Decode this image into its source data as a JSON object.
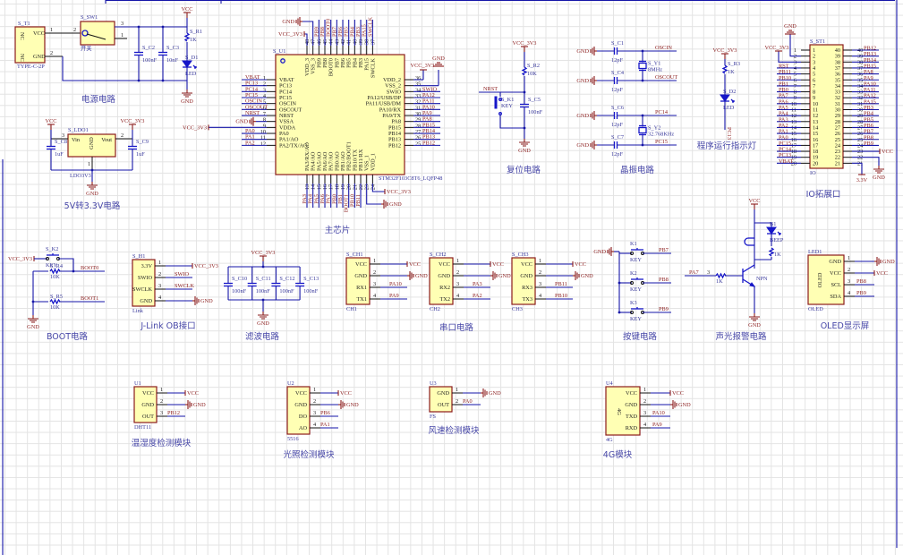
{
  "power": {
    "title": "电源电路",
    "vcc": "VCC",
    "gnd": "GND",
    "connector": {
      "ref": "S_T1",
      "value": "TYPE-C-2P",
      "pins": [
        {
          "num": "1",
          "name": "VCC"
        },
        {
          "num": "2",
          "name": "GND"
        }
      ],
      "nc": "NC"
    },
    "switch": {
      "ref": "S_SW1",
      "value": "开关",
      "pins": [
        "1",
        "2",
        "3"
      ]
    },
    "caps": [
      {
        "ref": "S_C2",
        "value": "100nF"
      },
      {
        "ref": "S_C3",
        "value": "10nF"
      }
    ],
    "resistor": {
      "ref": "S_R1",
      "value": "1K"
    },
    "led": {
      "ref": "S_D1",
      "value": "LED"
    }
  },
  "ldo": {
    "title": "5V转3.3V电路",
    "ref": "S_LDO1",
    "value": "LDO3V3",
    "vin": "Vin",
    "vout": "Vout",
    "gnd_pin": "GND",
    "pins": [
      "3",
      "2",
      "1"
    ],
    "in_net": "VCC",
    "out_net": "VCC_3V3",
    "gnd": "GND",
    "caps": [
      {
        "ref": "S_C8",
        "value": "1uF"
      },
      {
        "ref": "S_C9",
        "value": "1uF"
      }
    ]
  },
  "mcu": {
    "title": "主芯片",
    "ref": "S_U1",
    "value": "STM32F103C8T6_LQFP48",
    "left": [
      {
        "num": "1",
        "name": "VBAT",
        "net": "VBAT"
      },
      {
        "num": "2",
        "name": "PC13",
        "net": "PC13"
      },
      {
        "num": "3",
        "name": "PC14",
        "net": "PC14"
      },
      {
        "num": "4",
        "name": "PC15",
        "net": "PC15"
      },
      {
        "num": "5",
        "name": "OSCIN",
        "net": "OSCIN"
      },
      {
        "num": "6",
        "name": "OSCOUT",
        "net": "OSCOUT"
      },
      {
        "num": "7",
        "name": "NRST",
        "net": "NRST"
      },
      {
        "num": "8",
        "name": "VSSA",
        "net": "GND"
      },
      {
        "num": "9",
        "name": "VDDA",
        "net": "VCC_3V3"
      },
      {
        "num": "10",
        "name": "PA0",
        "net": "PA0"
      },
      {
        "num": "11",
        "name": "PA1/AO",
        "net": "PA1"
      },
      {
        "num": "12",
        "name": "PA2/TX/AO",
        "net": "PA2"
      }
    ],
    "right": [
      {
        "num": "36",
        "name": "VDD_2",
        "net": "VCC_3V3"
      },
      {
        "num": "35",
        "name": "VSS_2",
        "net": "GND"
      },
      {
        "num": "34",
        "name": "SWIO",
        "net": "SWIO"
      },
      {
        "num": "33",
        "name": "PA12/USB/DP",
        "net": "PA12"
      },
      {
        "num": "32",
        "name": "PA11/USB/DM",
        "net": "PA11"
      },
      {
        "num": "31",
        "name": "PA10/RX",
        "net": "PA10"
      },
      {
        "num": "30",
        "name": "PA9/TX",
        "net": "PA9"
      },
      {
        "num": "29",
        "name": "PA8",
        "net": "PA8"
      },
      {
        "num": "28",
        "name": "PB15",
        "net": "PB15"
      },
      {
        "num": "27",
        "name": "PB14",
        "net": "PB14"
      },
      {
        "num": "26",
        "name": "PB13",
        "net": "PB13"
      },
      {
        "num": "25",
        "name": "PB12",
        "net": "PB12"
      }
    ],
    "top": [
      {
        "num": "48",
        "name": "VDD_3",
        "net": "VCC_3V3"
      },
      {
        "num": "47",
        "name": "VSS_3",
        "net": "GND"
      },
      {
        "num": "46",
        "name": "PB9",
        "net": "PB9"
      },
      {
        "num": "45",
        "name": "PB8",
        "net": "PB8"
      },
      {
        "num": "44",
        "name": "BOOT0",
        "net": "BOOT0"
      },
      {
        "num": "43",
        "name": "PB7",
        "net": "PB7"
      },
      {
        "num": "42",
        "name": "PB6",
        "net": "PB6"
      },
      {
        "num": "41",
        "name": "PB5",
        "net": "PB5"
      },
      {
        "num": "40",
        "name": "PB4",
        "net": "PB4"
      },
      {
        "num": "39",
        "name": "PB3",
        "net": "PB3"
      },
      {
        "num": "38",
        "name": "PA15",
        "net": "PA15"
      },
      {
        "num": "37",
        "name": "SWCLK",
        "net": "SWCLK"
      }
    ],
    "bottom": [
      {
        "num": "13",
        "name": "PA3/RX/AO",
        "net": "PA3"
      },
      {
        "num": "14",
        "name": "PA4/AO",
        "net": "PA4"
      },
      {
        "num": "15",
        "name": "PA5/AO",
        "net": "PA5"
      },
      {
        "num": "16",
        "name": "PA6/AO",
        "net": "PA6"
      },
      {
        "num": "17",
        "name": "PA7/AO",
        "net": "PA7"
      },
      {
        "num": "18",
        "name": "PB0/AO",
        "net": "PB0"
      },
      {
        "num": "19",
        "name": "PB1/AO",
        "net": "PB1"
      },
      {
        "num": "20",
        "name": "PB2/BOOT1",
        "net": "BOOT1"
      },
      {
        "num": "21",
        "name": "PB10/TX",
        "net": "PB10"
      },
      {
        "num": "22",
        "name": "PB11/RX",
        "net": "PB11"
      },
      {
        "num": "23",
        "name": "VSS_1",
        "net": "GND"
      },
      {
        "num": "24",
        "name": "VDD_1",
        "net": "VCC_3V3"
      }
    ]
  },
  "reset": {
    "title": "复位电路",
    "vcc": "VCC_3V3",
    "gnd": "GND",
    "net": "NRST",
    "resistor": {
      "ref": "S_R2",
      "value": "10K"
    },
    "cap": {
      "ref": "S_C5",
      "value": "100nF"
    },
    "key": {
      "ref": "S_K1",
      "value": "KEY"
    }
  },
  "crystal": {
    "title": "晶振电路",
    "gnd": "GND",
    "caps": [
      {
        "ref": "S_C1",
        "value": "12pF"
      },
      {
        "ref": "S_C4",
        "value": "12pF"
      },
      {
        "ref": "S_C6",
        "value": "12pF"
      },
      {
        "ref": "S_C7",
        "value": "12pF"
      }
    ],
    "crystals": [
      {
        "ref": "S_Y1",
        "value": "8MHz"
      },
      {
        "ref": "S_Y2",
        "value": "32.768KHz"
      }
    ],
    "nets": [
      "OSCIN",
      "OSCOUT",
      "PC14",
      "PC15"
    ]
  },
  "run_led": {
    "title": "程序运行指示灯",
    "vcc": "VCC_3V3",
    "resistor": {
      "ref": "S_R3",
      "value": "1K"
    },
    "led": {
      "ref": "S_D2",
      "value": "LED"
    },
    "net": "PC13"
  },
  "io": {
    "title": "IO拓展口",
    "ref": "S_ST1",
    "value": "IO",
    "gnd": "GND",
    "left": [
      {
        "num": "1",
        "net": ""
      },
      {
        "num": "2",
        "net": "GND"
      },
      {
        "num": "3",
        "net": "VCC_3V3"
      },
      {
        "num": "4",
        "net": "RST"
      },
      {
        "num": "5",
        "net": "PB11"
      },
      {
        "num": "6",
        "net": "PB10"
      },
      {
        "num": "7",
        "net": "PB1"
      },
      {
        "num": "8",
        "net": "PB0"
      },
      {
        "num": "9",
        "net": "PA7"
      },
      {
        "num": "10",
        "net": "PA6"
      },
      {
        "num": "11",
        "net": "PA5"
      },
      {
        "num": "12",
        "net": "PA4"
      },
      {
        "num": "13",
        "net": "PA3"
      },
      {
        "num": "14",
        "net": "PA2"
      },
      {
        "num": "15",
        "net": "PA1"
      },
      {
        "num": "16",
        "net": "PA0"
      },
      {
        "num": "17",
        "net": "PC15"
      },
      {
        "num": "18",
        "net": "PC14"
      },
      {
        "num": "19",
        "net": "PC13"
      },
      {
        "num": "20",
        "net": "VBAT"
      }
    ],
    "right": [
      {
        "num": "40",
        "net": "PB12"
      },
      {
        "num": "39",
        "net": "PB13"
      },
      {
        "num": "38",
        "net": "PB14"
      },
      {
        "num": "37",
        "net": "PB15"
      },
      {
        "num": "36",
        "net": "PA8"
      },
      {
        "num": "35",
        "net": "PA9"
      },
      {
        "num": "34",
        "net": "PA10"
      },
      {
        "num": "33",
        "net": "PA11"
      },
      {
        "num": "32",
        "net": "PA12"
      },
      {
        "num": "31",
        "net": "PA15"
      },
      {
        "num": "30",
        "net": "PB3"
      },
      {
        "num": "29",
        "net": "PB4"
      },
      {
        "num": "28",
        "net": "PB5"
      },
      {
        "num": "27",
        "net": "PB6"
      },
      {
        "num": "26",
        "net": "PB7"
      },
      {
        "num": "25",
        "net": "PB8"
      },
      {
        "num": "24",
        "net": "PB9"
      },
      {
        "num": "23",
        "net": "VCC"
      },
      {
        "num": "22",
        "net": "GND"
      },
      {
        "num": "21",
        "net": "3.3V"
      }
    ]
  },
  "boot": {
    "title": "BOOT电路",
    "vcc": "VCC_3V3",
    "gnd": "GND",
    "key": {
      "ref": "S_K2",
      "value": "KEY"
    },
    "resistors": [
      {
        "ref": "S_R4",
        "value": "10K"
      },
      {
        "ref": "S_R5",
        "value": "10K"
      }
    ],
    "nets": [
      "BOOT0",
      "BOOT1"
    ]
  },
  "jlink": {
    "title": "J-Link OB接口",
    "ref": "S_H1",
    "value": "Link",
    "pins": [
      {
        "num": "1",
        "name": "3.3V",
        "net": "VCC_3V3"
      },
      {
        "num": "2",
        "name": "SWIO",
        "net": "SWIO"
      },
      {
        "num": "3",
        "name": "SWCLK",
        "net": "SWCLK"
      },
      {
        "num": "4",
        "name": "GND",
        "net": "GND"
      }
    ]
  },
  "filter": {
    "title": "滤波电路",
    "vcc": "VCC_3V3",
    "gnd": "GND",
    "caps": [
      {
        "ref": "S_C10",
        "value": "100nF"
      },
      {
        "ref": "S_C11",
        "value": "100nF"
      },
      {
        "ref": "S_C12",
        "value": "100nF"
      },
      {
        "ref": "S_C13",
        "value": "100nF"
      }
    ]
  },
  "serial": {
    "title": "串口电路",
    "ports": [
      {
        "ref": "S_CH1",
        "value": "CH1",
        "pins": [
          {
            "num": "1",
            "name": "VCC",
            "net": "VCC"
          },
          {
            "num": "2",
            "name": "GND",
            "net": "GND"
          },
          {
            "num": "3",
            "name": "RX1",
            "net": "PA10"
          },
          {
            "num": "4",
            "name": "TX1",
            "net": "PA9"
          }
        ]
      },
      {
        "ref": "S_CH2",
        "value": "CH2",
        "pins": [
          {
            "num": "1",
            "name": "VCC",
            "net": "VCC"
          },
          {
            "num": "2",
            "name": "GND",
            "net": "GND"
          },
          {
            "num": "3",
            "name": "RX2",
            "net": "PA3"
          },
          {
            "num": "4",
            "name": "TX2",
            "net": "PA2"
          }
        ]
      },
      {
        "ref": "S_CH3",
        "value": "CH3",
        "pins": [
          {
            "num": "1",
            "name": "VCC",
            "net": "VCC"
          },
          {
            "num": "2",
            "name": "GND",
            "net": "GND"
          },
          {
            "num": "3",
            "name": "RX3",
            "net": "PB11"
          },
          {
            "num": "4",
            "name": "TX3",
            "net": "PB10"
          }
        ]
      }
    ]
  },
  "keys": {
    "title": "按键电路",
    "gnd": "GND",
    "keys": [
      {
        "ref": "K1",
        "value": "KEY",
        "net": "PB7"
      },
      {
        "ref": "K2",
        "value": "KEY",
        "net": "PB8"
      },
      {
        "ref": "K3",
        "value": "KEY",
        "net": "PB9"
      }
    ]
  },
  "alarm": {
    "title": "声光报警电路",
    "vcc": "VCC",
    "gnd": "GND",
    "buzzer": {
      "ref": "B1",
      "value": "BEEP"
    },
    "transistor": "NPN",
    "base_resistor": "1K",
    "led_resistor": "1K",
    "net": "PA7",
    "pin": "3"
  },
  "oled": {
    "title": "OLED显示屏",
    "ref": "LED1",
    "value": "OLED",
    "label": "OLED",
    "pins": [
      {
        "num": "1",
        "name": "GND",
        "net": "GND"
      },
      {
        "num": "2",
        "name": "VCC",
        "net": "VCC"
      },
      {
        "num": "3",
        "name": "SCL",
        "net": "PB8"
      },
      {
        "num": "4",
        "name": "SDA",
        "net": "PB9"
      }
    ]
  },
  "dht": {
    "title": "温湿度检测模块",
    "ref": "U1",
    "value": "DHT11",
    "pins": [
      {
        "num": "1",
        "name": "VCC",
        "net": "VCC"
      },
      {
        "num": "2",
        "name": "GND",
        "net": "GND"
      },
      {
        "num": "3",
        "name": "OUT",
        "net": "PB12"
      }
    ]
  },
  "light": {
    "title": "光照检测模块",
    "ref": "U2",
    "value": "5516",
    "pins": [
      {
        "num": "1",
        "name": "VCC",
        "net": "VCC"
      },
      {
        "num": "2",
        "name": "GND",
        "net": "GND"
      },
      {
        "num": "3",
        "name": "DO",
        "net": "PB6"
      },
      {
        "num": "4",
        "name": "AO",
        "net": "PA1"
      }
    ]
  },
  "wind": {
    "title": "风速检测模块",
    "ref": "U3",
    "value": "FS",
    "pins": [
      {
        "num": "1",
        "name": "GND",
        "net": "GND"
      },
      {
        "num": "2",
        "name": "OUT",
        "net": "PA0"
      }
    ]
  },
  "g4": {
    "title": "4G模块",
    "ref": "U4",
    "value": "4G",
    "label": "4G",
    "pins": [
      {
        "num": "1",
        "name": "VCC",
        "net": "VCC"
      },
      {
        "num": "2",
        "name": "GND",
        "net": "GND"
      },
      {
        "num": "3",
        "name": "TXD",
        "net": "PA10"
      },
      {
        "num": "4",
        "name": "RXD",
        "net": "PA9"
      }
    ]
  },
  "colors": {
    "wire": "#1616a8",
    "part_outline": "#8b1c1c",
    "part_fill": "#ffffb4",
    "net_label": "#8b1c1c",
    "designator": "#3a3a9c",
    "grid": "#e3e3e3"
  }
}
